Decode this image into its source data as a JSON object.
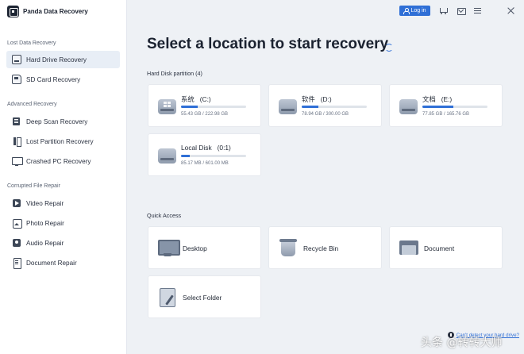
{
  "app": {
    "name": "Panda Data Recovery"
  },
  "header": {
    "login_label": "Log in"
  },
  "sidebar": {
    "sections": [
      {
        "title": "Lost Data Recovery",
        "items": [
          {
            "label": "Hard Drive Recovery",
            "icon": "hard-drive-icon",
            "active": true
          },
          {
            "label": "SD Card Recovery",
            "icon": "sd-card-icon"
          }
        ]
      },
      {
        "title": "Advanced Recovery",
        "items": [
          {
            "label": "Deep Scan Recovery",
            "icon": "deep-scan-icon"
          },
          {
            "label": "Lost Partition Recovery",
            "icon": "partition-icon"
          },
          {
            "label": "Crashed PC Recovery",
            "icon": "pc-icon"
          }
        ]
      },
      {
        "title": "Corrupted File Repair",
        "items": [
          {
            "label": "Video Repair",
            "icon": "video-icon"
          },
          {
            "label": "Photo Repair",
            "icon": "photo-icon"
          },
          {
            "label": "Audio Repair",
            "icon": "audio-icon"
          },
          {
            "label": "Document Repair",
            "icon": "document-icon"
          }
        ]
      }
    ]
  },
  "main": {
    "title": "Select a location to start recovery",
    "partitions_heading": "Hard Disk partition",
    "partitions_count": "(4)",
    "partitions": [
      {
        "name": "系统",
        "letter": "(C:)",
        "size": "55.43 GB / 222.98 GB",
        "used_fraction": 0.25,
        "windows": true
      },
      {
        "name": "软件",
        "letter": "(D:)",
        "size": "78.94 GB / 300.00 GB",
        "used_fraction": 0.26,
        "windows": false
      },
      {
        "name": "文档",
        "letter": "(E:)",
        "size": "77.85 GB / 165.76 GB",
        "used_fraction": 0.47,
        "windows": false
      },
      {
        "name": "Local Disk",
        "letter": "(0:1)",
        "size": "85.17 MB / 601.00 MB",
        "used_fraction": 0.14,
        "windows": false
      }
    ],
    "quick_access_heading": "Quick Access",
    "quick_access": [
      {
        "label": "Desktop",
        "icon": "desktop-icon"
      },
      {
        "label": "Recycle Bin",
        "icon": "recycle-bin-icon"
      },
      {
        "label": "Document",
        "icon": "document-folder-icon"
      },
      {
        "label": "Select Folder",
        "icon": "select-folder-icon"
      }
    ]
  },
  "footer": {
    "help_link": "Can't detect your hard drive?"
  },
  "watermark": "头条 @转转大师",
  "colors": {
    "accent": "#2f6fd6",
    "sidebar_active": "#e8eef6",
    "background": "#eef1f5"
  }
}
